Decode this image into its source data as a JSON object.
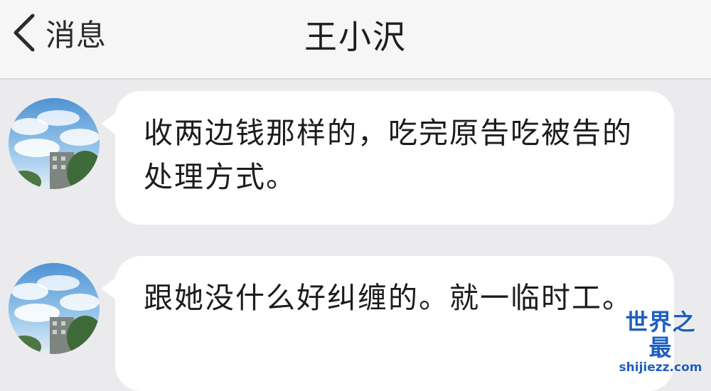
{
  "nav": {
    "back_label": "消息",
    "title": "王小沢"
  },
  "messages": [
    {
      "text": "收两边钱那样的，吃完原告吃被告的处理方式。",
      "avatar": "building-sky-avatar"
    },
    {
      "text": "跟她没什么好纠缠的。就一临时工。",
      "avatar": "building-sky-avatar"
    }
  ],
  "watermark": {
    "title": "世界之最",
    "url": "shijiezz.com"
  },
  "colors": {
    "background": "#ebebed",
    "nav_background": "#f6f6f7",
    "bubble": "#ffffff",
    "watermark": "#1f5fbf"
  },
  "icons": {
    "back": "chevron-left-icon"
  }
}
